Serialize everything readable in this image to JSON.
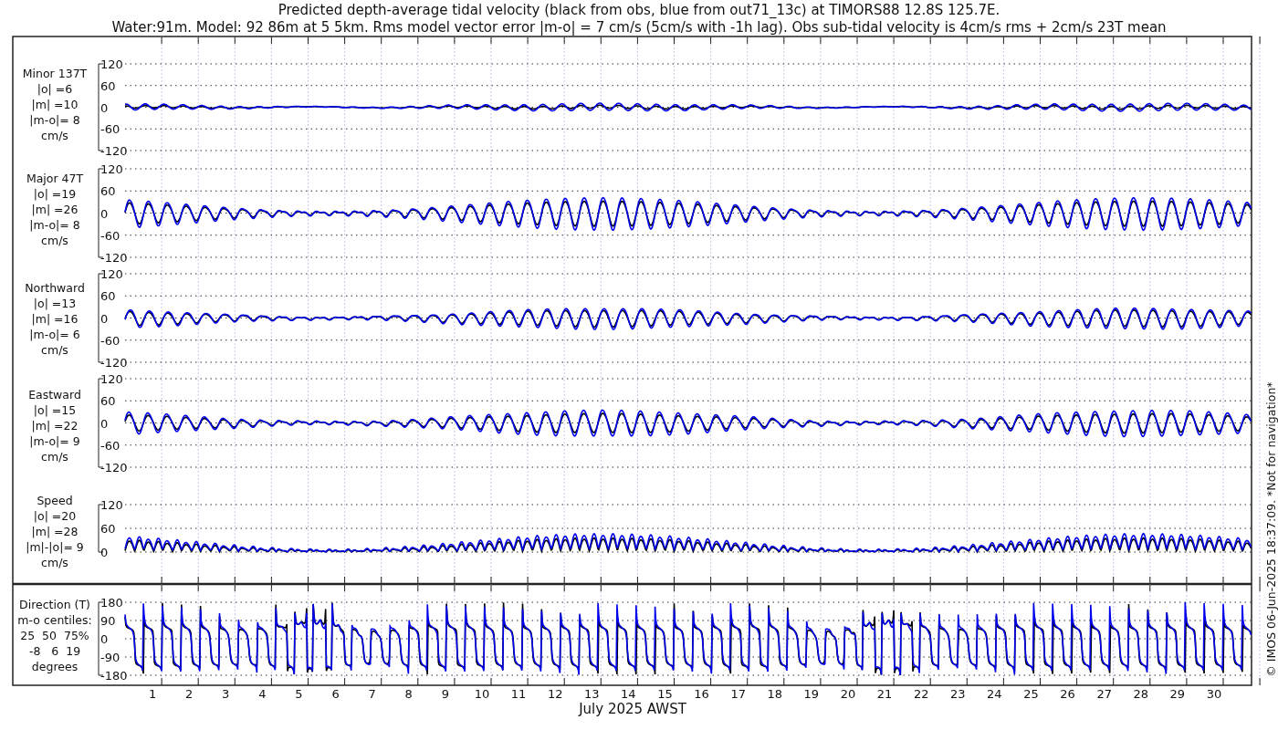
{
  "title_lines": [
    "Predicted depth-average tidal velocity (black from obs, blue from out71_13c) at TIMORS88 12.8S 125.7E.",
    "Water:91m. Model: 92 86m at 5 5km. Rms model vector error |m-o| = 7 cm/s (5cm/s with -1h lag). Obs sub-tidal velocity is 4cm/s rms + 2cm/s 23T mean"
  ],
  "panels": [
    {
      "kind": "velocity",
      "label_lines": [
        "Minor 137T",
        "|o| =6",
        "|m| =10",
        "|m-o|= 8",
        "cm/s"
      ],
      "yticks": [
        "120",
        "60",
        "0",
        "-60",
        "-120"
      ]
    },
    {
      "kind": "velocity",
      "label_lines": [
        "Major 47T",
        "|o| =19",
        "|m| =26",
        "|m-o|= 8",
        "cm/s"
      ],
      "yticks": [
        "120",
        "60",
        "0",
        "-60",
        "-120"
      ]
    },
    {
      "kind": "velocity",
      "label_lines": [
        "Northward",
        "|o| =13",
        "|m| =16",
        "|m-o|= 6",
        "cm/s"
      ],
      "yticks": [
        "120",
        "60",
        "0",
        "-60",
        "-120"
      ]
    },
    {
      "kind": "velocity",
      "label_lines": [
        "Eastward",
        "|o| =15",
        "|m| =22",
        "|m-o|= 9",
        "cm/s"
      ],
      "yticks": [
        "120",
        "60",
        "0",
        "-60",
        "-120"
      ]
    },
    {
      "kind": "speed",
      "label_lines": [
        "Speed",
        "|o| =20",
        "|m| =28",
        "|m|-|o|= 9",
        "cm/s"
      ],
      "yticks": [
        "120",
        "60",
        "0"
      ]
    },
    {
      "kind": "direction",
      "label_lines": [
        "Direction (T)",
        "m-o centiles:",
        "25  50  75%",
        "-8   6  19",
        "degrees"
      ],
      "yticks": [
        "180",
        "90",
        "0",
        "-90",
        "-180"
      ]
    }
  ],
  "xticks": [
    "1",
    "2",
    "3",
    "4",
    "5",
    "6",
    "7",
    "8",
    "9",
    "10",
    "11",
    "12",
    "13",
    "14",
    "15",
    "16",
    "17",
    "18",
    "19",
    "20",
    "21",
    "22",
    "23",
    "24",
    "25",
    "26",
    "27",
    "28",
    "29",
    "30"
  ],
  "xlabel": "July 2025 AWST",
  "credit": "© IMOS 06-Jun-2025 18:37:09. *Not for navigation*"
}
